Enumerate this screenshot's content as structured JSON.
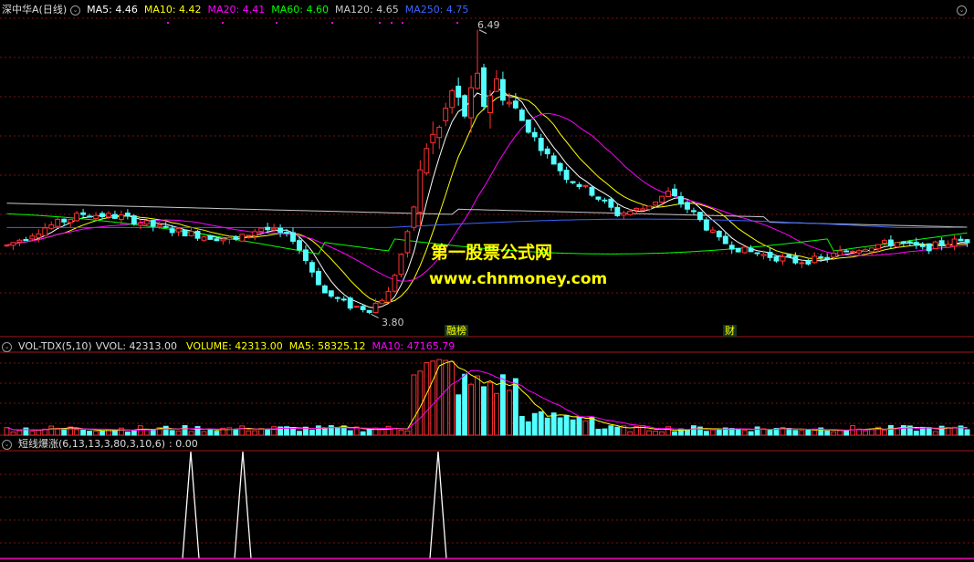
{
  "main_header": {
    "title": "深中华A(日线)",
    "ma5": "MA5: 4.46",
    "ma10": "MA10: 4.42",
    "ma20": "MA20: 4.41",
    "ma60": "MA60: 4.60",
    "ma120": "MA120: 4.65",
    "ma250": "MA250: 4.75"
  },
  "annotations": {
    "high_label": "6.49",
    "low_label": "3.80",
    "event_badge_1": "融榜",
    "event_badge_2": "财"
  },
  "watermark": {
    "line1": "第一股票公式网",
    "line2": "www.chnmoney.com"
  },
  "volume_header": {
    "name": "VOL-TDX(5,10)",
    "vvol": "VVOL: 42313.00",
    "volume": "VOLUME: 42313.00",
    "ma5": "MA5: 58325.12",
    "ma10": "MA10: 47165.79"
  },
  "indicator_header": {
    "name": "短线爆涨(6,13,13,3,80,3,10,6)",
    "value": ": 0.00"
  },
  "colors": {
    "up": "#ff3232",
    "down": "#54ffff",
    "ma5": "#ffffff",
    "ma10": "#ffff00",
    "ma20": "#ff00ff",
    "ma60": "#00ff00",
    "ma120": "#c8c8c8",
    "ma250": "#3c64ff",
    "grid": "#7a1010"
  },
  "chart_data": {
    "type": "candlestick",
    "price_range": [
      3.8,
      6.49
    ],
    "high": 6.49,
    "low": 3.8,
    "panels": [
      "price",
      "volume",
      "indicator"
    ],
    "indicator_spikes": 3
  }
}
